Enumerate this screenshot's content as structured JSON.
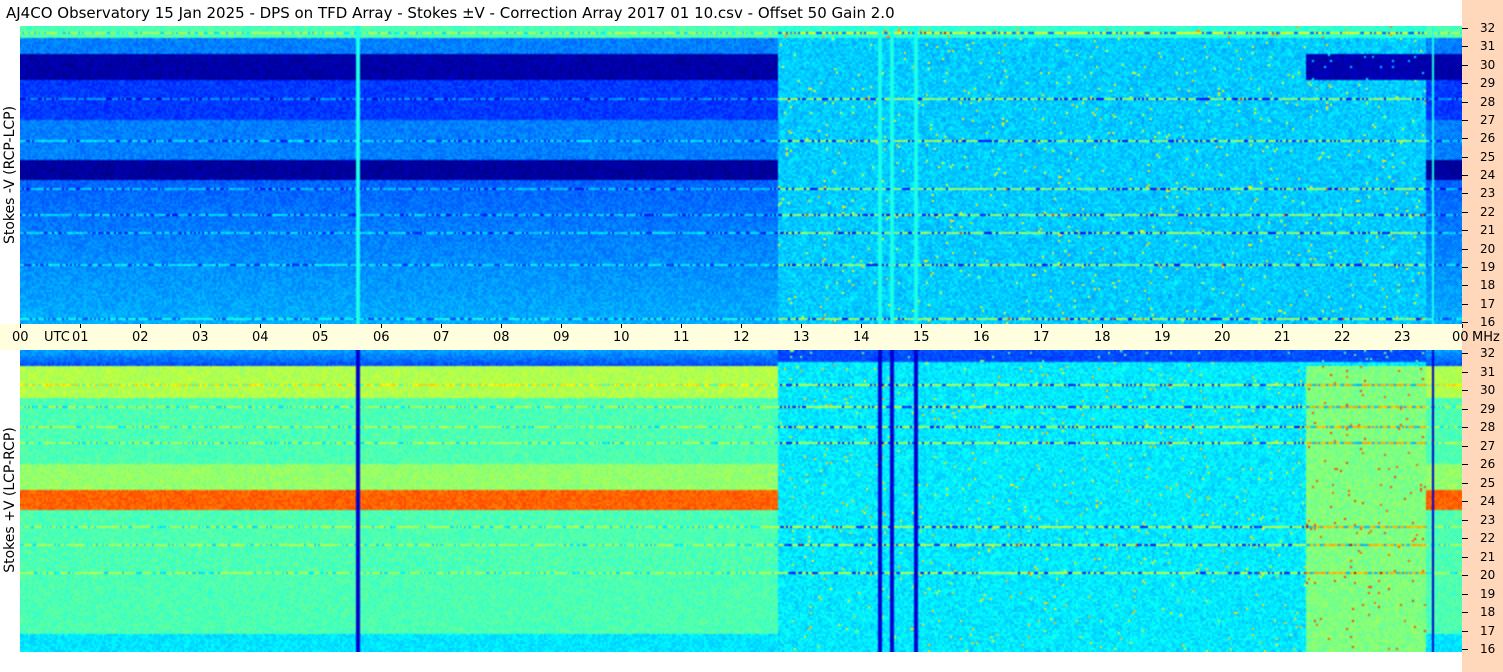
{
  "title": "AJ4CO Observatory  15 Jan 2025  -  DPS on TFD Array  -  Stokes ±V  -  Correction Array 2017 01 10.csv  -  Offset 50  Gain 2.0",
  "panels": {
    "top": {
      "label": "Stokes -V (RCP-LCP)"
    },
    "bottom": {
      "label": "Stokes +V (LCP-RCP)"
    }
  },
  "time_axis": {
    "labels": [
      "00",
      "UTC",
      "01",
      "02",
      "03",
      "04",
      "05",
      "06",
      "07",
      "08",
      "09",
      "10",
      "11",
      "12",
      "13",
      "14",
      "15",
      "16",
      "17",
      "18",
      "19",
      "20",
      "21",
      "22",
      "23",
      "00",
      "MHz"
    ]
  },
  "colors": {
    "title_bg": "#ffffff",
    "axis_bg": "#ffffe0",
    "right_strip_bg": "#ffd8bc"
  },
  "chart_data": {
    "type": "heatmap",
    "x_axis": {
      "unit": "UTC hour",
      "range": [
        0,
        24
      ],
      "ticks": [
        0,
        1,
        2,
        3,
        4,
        5,
        6,
        7,
        8,
        9,
        10,
        11,
        12,
        13,
        14,
        15,
        16,
        17,
        18,
        19,
        20,
        21,
        22,
        23,
        24
      ]
    },
    "y_axis": {
      "unit": "MHz",
      "range": [
        16,
        32
      ],
      "ticks": [
        16,
        17,
        18,
        19,
        20,
        21,
        22,
        23,
        24,
        25,
        26,
        27,
        28,
        29,
        30,
        31,
        32
      ]
    },
    "panels": [
      {
        "name": "Stokes -V (RCP-LCP)",
        "colormap": "jet",
        "dark_bands_mhz": [
          [
            29.2,
            30.6
          ],
          [
            23.8,
            24.9
          ]
        ],
        "day_transition_utc": [
          12.6,
          23.4
        ],
        "vertical_lines_utc": [
          5.6,
          14.3,
          14.5,
          14.9,
          23.5
        ]
      },
      {
        "name": "Stokes +V (LCP-RCP)",
        "colormap": "jet",
        "bright_band_mhz": [
          23.6,
          24.6
        ],
        "day_transition_utc": [
          12.6,
          23.4
        ],
        "vertical_lines_utc": [
          5.6,
          14.3,
          14.5,
          14.9,
          23.5
        ]
      }
    ]
  }
}
